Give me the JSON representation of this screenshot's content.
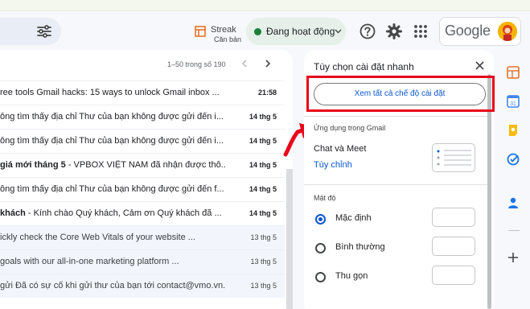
{
  "header": {
    "streak_title": "Streak",
    "streak_subtitle": "Căn bản",
    "status_label": "Đang hoạt động",
    "brand": "Google",
    "colors": {
      "status_dot": "#188038",
      "chip_bg": "#e6f0e9"
    }
  },
  "mail": {
    "pagination": "1–50 trong số 190",
    "rows": [
      {
        "bold": "",
        "text": "ree tools    Gmail hacks: 15 ways to unlock Gmail inbox ...",
        "date": "21:58",
        "read": false
      },
      {
        "bold": "",
        "text": "ông tìm thấy địa chỉ Thư của bạn không được gửi đến i...",
        "date": "14 thg 5",
        "read": false
      },
      {
        "bold": "",
        "text": "ông tìm thấy địa chỉ Thư của bạn không được gửi đến i...",
        "date": "14 thg 5",
        "read": false
      },
      {
        "bold": "giá mới tháng 5",
        "text": " - VPBOX VIỆT NAM đã nhận được thô...",
        "date": "14 thg 5",
        "read": false
      },
      {
        "bold": "",
        "text": "ông tìm thấy địa chỉ Thư của bạn không được gửi đến f...",
        "date": "14 thg 5",
        "read": false
      },
      {
        "bold": "khách",
        "text": " - Kính chào Quý khách, Cảm ơn Quý khách đã ...",
        "date": "14 thg 5",
        "read": false
      },
      {
        "bold": "",
        "text": "ickly check the Core Web Vitals of your website          ...",
        "date": "13 thg 5",
        "read": true
      },
      {
        "bold": "",
        "text": "goals with our all-in-one marketing platform              ...",
        "date": "13 thg 5",
        "read": true
      },
      {
        "bold": "",
        "text": "gửi Đã có sự cố khi gửi thư của bạn tới contact@vmo.vn...",
        "date": "13 thg 5",
        "read": true
      }
    ]
  },
  "quick_settings": {
    "title": "Tùy chọn cài đặt nhanh",
    "see_all": "Xem tất cả chế độ cài đặt",
    "apps_section": "Ứng dụng trong Gmail",
    "chat_meet": "Chat và Meet",
    "customize": "Tùy chỉnh",
    "density_section": "Mật độ",
    "density_options": [
      {
        "label": "Mặc định",
        "selected": true
      },
      {
        "label": "Bình thường",
        "selected": false
      },
      {
        "label": "Thu gọn",
        "selected": false
      }
    ],
    "highlight_color": "#e8061b"
  },
  "side_rail": {
    "icons": [
      "sheets-icon",
      "calendar-icon",
      "keep-icon",
      "tasks-icon",
      "contacts-icon",
      "add-icon"
    ]
  }
}
